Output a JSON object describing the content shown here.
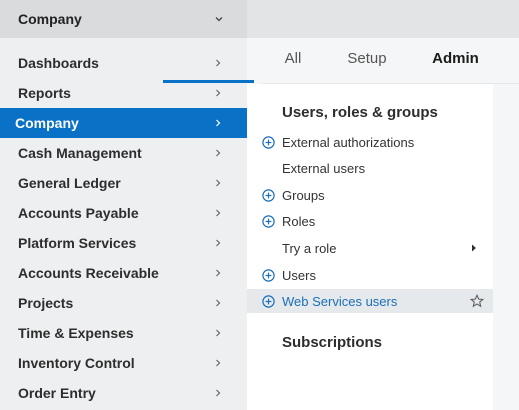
{
  "module_selector": {
    "label": "Company",
    "icon": "chevron-down-icon"
  },
  "sidebar": {
    "items": [
      {
        "label": "Dashboards"
      },
      {
        "label": "Reports"
      },
      {
        "label": "Company"
      },
      {
        "label": "Cash Management"
      },
      {
        "label": "General Ledger"
      },
      {
        "label": "Accounts Payable"
      },
      {
        "label": "Platform Services"
      },
      {
        "label": "Accounts Receivable"
      },
      {
        "label": "Projects"
      },
      {
        "label": "Time & Expenses"
      },
      {
        "label": "Inventory Control"
      },
      {
        "label": "Order Entry"
      }
    ],
    "active_index": 2
  },
  "tabs": [
    {
      "label": "All"
    },
    {
      "label": "Setup"
    },
    {
      "label": "Admin"
    }
  ],
  "active_tab": "Admin",
  "sections": {
    "users_title": "Users, roles & groups",
    "items": [
      {
        "label": "External authorizations",
        "has_plus": true
      },
      {
        "label": "External users",
        "has_plus": false
      },
      {
        "label": "Groups",
        "has_plus": true
      },
      {
        "label": "Roles",
        "has_plus": true
      },
      {
        "label": "Try a role",
        "has_plus": false,
        "has_submenu": true
      },
      {
        "label": "Users",
        "has_plus": true
      },
      {
        "label": "Web Services users",
        "has_plus": true,
        "highlighted": true,
        "favorite_icon": "star-icon"
      }
    ],
    "subscriptions_title": "Subscriptions"
  },
  "colors": {
    "accent": "#0a72c6",
    "sidebar_bg": "#eeeff1",
    "topbar_bg": "#e2e4e6",
    "highlight_bg": "#e6e9ec",
    "link_text": "#1a6fb8"
  }
}
